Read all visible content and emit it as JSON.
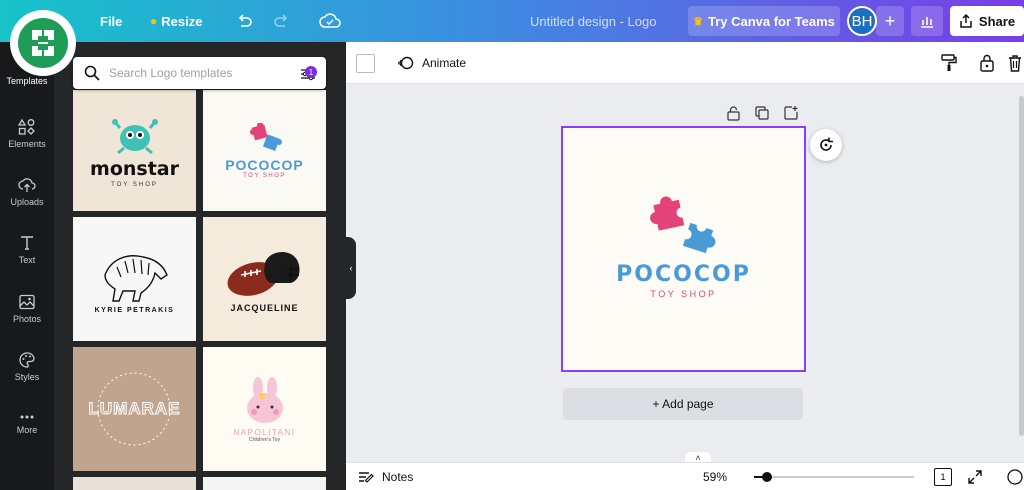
{
  "topbar": {
    "file_label": "File",
    "resize_label": "Resize",
    "title": "Untitled design - Logo",
    "try_label": "Try Canva for Teams",
    "avatar_initials": "BH",
    "share_label": "Share"
  },
  "sidebar": {
    "items": [
      {
        "label": "Templates",
        "icon": "templates-icon"
      },
      {
        "label": "Elements",
        "icon": "elements-icon"
      },
      {
        "label": "Uploads",
        "icon": "upload-icon"
      },
      {
        "label": "Text",
        "icon": "text-icon"
      },
      {
        "label": "Photos",
        "icon": "photos-icon"
      },
      {
        "label": "Styles",
        "icon": "palette-icon"
      },
      {
        "label": "More",
        "icon": "more-icon"
      }
    ]
  },
  "panel": {
    "search_placeholder": "Search Logo templates",
    "filter_count": "1",
    "templates": [
      {
        "name": "monstar",
        "sub": "TOY SHOP"
      },
      {
        "name": "POCOCOP",
        "sub": "TOY SHOP"
      },
      {
        "name": "KYRIE PETRAKIS",
        "sub": ""
      },
      {
        "name": "JACQUELINE",
        "sub": ""
      },
      {
        "name": "LUMARAE",
        "sub": ""
      },
      {
        "name": "NAPOLITANI",
        "sub": "Children's Toy"
      }
    ]
  },
  "editor": {
    "animate_label": "Animate",
    "add_page_label": "+ Add page",
    "notes_label": "Notes",
    "zoom_value": "59%",
    "zoom_fraction": 0.59,
    "page_count": "1"
  },
  "canvas_logo": {
    "name": "POCOCOP",
    "sub": "TOY SHOP"
  },
  "colors": {
    "accent": "#8b3dff",
    "logo_blue": "#4a9ad8",
    "logo_pink": "#e4437a"
  }
}
